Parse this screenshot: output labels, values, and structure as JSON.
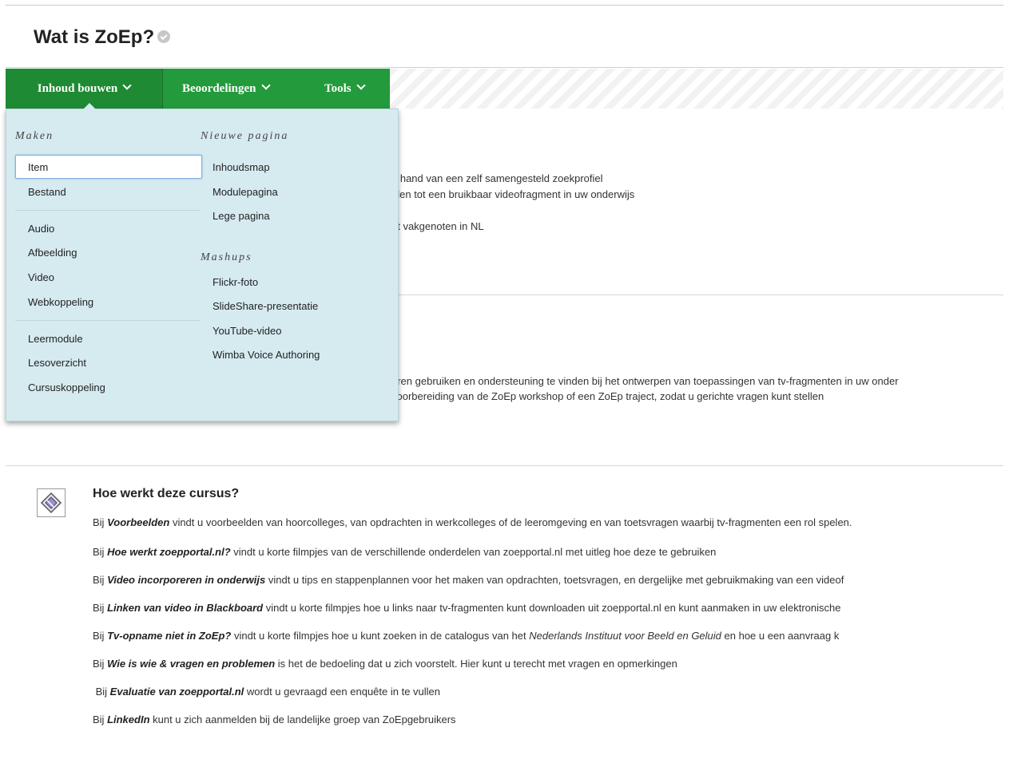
{
  "page": {
    "title": "Wat is ZoEp?"
  },
  "menubar": {
    "items": [
      {
        "label": "Inhoud bouwen"
      },
      {
        "label": "Beoordelingen"
      },
      {
        "label": "Tools"
      }
    ]
  },
  "dropdown": {
    "col1_heading": "Maken",
    "col1_items": [
      "Item",
      "Bestand",
      "Audio",
      "Afbeelding",
      "Video",
      "Webkoppeling",
      "Leermodule",
      "Lesoverzicht",
      "Cursuskoppeling"
    ],
    "col2_heading": "Nieuwe pagina",
    "col2_items": [
      "Inhoudsmap",
      "Modulepagina",
      "Lege pagina"
    ],
    "col3_heading": "Mashups",
    "col3_items": [
      "Flickr-foto",
      "SlideShare-presentatie",
      "YouTube-video",
      "Wimba Voice Authoring"
    ]
  },
  "background_text": {
    "lines_a": [
      "e hand van een zelf samengesteld zoekprofiel",
      "jden tot een bruikbaar videofragment in uw onderwijs",
      "n",
      "et vakgenoten in NL"
    ],
    "lines_b": [
      "eren gebruiken en ondersteuning te vinden bij het ontwerpen van toepassingen van tv-fragmenten in uw onder",
      "voorbereiding van de ZoEp workshop of een ZoEp traject, zodat u gerichte vragen kunt stellen"
    ]
  },
  "section": {
    "title": "Hoe werkt deze cursus?",
    "paragraphs": [
      {
        "pre": "Bij ",
        "bold": "Voorbeelden",
        "rest": " vindt u voorbeelden van hoorcolleges, van opdrachten in werkcolleges of de leeromgeving en van toetsvragen waarbij tv-fragmenten een rol spelen."
      },
      {
        "pre": "Bij ",
        "bold": "Hoe werkt zoepportal.nl?",
        "rest": " vindt u korte filmpjes van de verschillende onderdelen van zoepportal.nl met uitleg hoe deze te gebruiken"
      },
      {
        "pre": "Bij ",
        "bold": "Video incorporeren in onderwijs",
        "rest": " vindt u tips en stappenplannen voor het maken van opdrachten, toetsvragen, en dergelijke met gebruikmaking van een videof"
      },
      {
        "pre": "Bij ",
        "bold": "Linken van video in Blackboard",
        "rest": " vindt u korte filmpjes hoe u links naar tv-fragmenten kunt downloaden uit zoepportal.nl en kunt aanmaken in uw elektronische"
      },
      {
        "pre": "Bij ",
        "bold": "Tv-opname niet in ZoEp?",
        "rest": " vindt u korte filmpjes hoe u kunt zoeken in de catalogus van het ",
        "italic": "Nederlands Instituut voor Beeld en Geluid",
        "rest2": " en hoe u een aanvraag k"
      },
      {
        "pre": "Bij ",
        "bold": "Wie is wie & vragen en problemen",
        "rest": " is het de bedoeling dat u zich voorstelt. Hier kunt u terecht met vragen en opmerkingen"
      },
      {
        "pre": " Bij ",
        "bold": "Evaluatie van zoepportal.nl",
        "rest": " wordt u gevraagd een enquête in te vullen"
      },
      {
        "pre": "Bij ",
        "bold": "LinkedIn",
        "rest": " kunt u zich aanmelden bij de landelijke groep van ZoEpgebruikers"
      }
    ]
  }
}
